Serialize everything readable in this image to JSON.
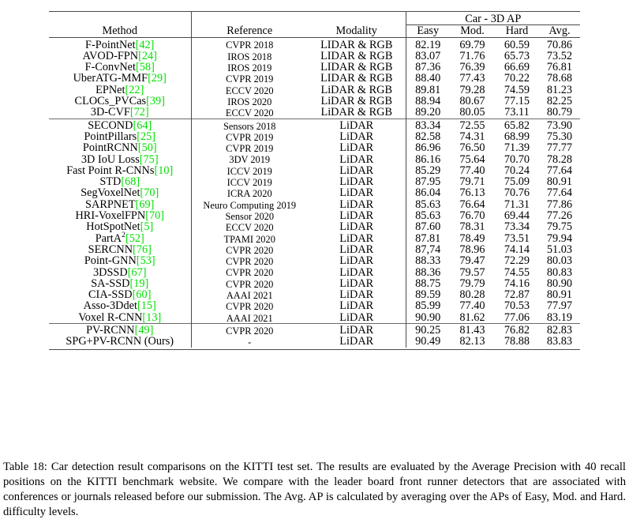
{
  "table": {
    "group_header": "Car - 3D AP",
    "columns": [
      "Method",
      "Reference",
      "Modality",
      "Easy",
      "Mod.",
      "Hard",
      "Avg."
    ],
    "groups": [
      {
        "name": "lidar-rgb-group",
        "rows": [
          {
            "method": "F-PointNet",
            "cite": "42",
            "reference": "CVPR 2018",
            "modality": "LIDAR & RGB",
            "easy": "82.19",
            "mod": "69.79",
            "hard": "60.59",
            "avg": "70.86"
          },
          {
            "method": "AVOD-FPN",
            "cite": "24",
            "reference": "IROS 2018",
            "modality": "LIDAR & RGB",
            "easy": "83.07",
            "mod": "71.76",
            "hard": "65.73",
            "avg": "73.52"
          },
          {
            "method": "F-ConvNet",
            "cite": "58",
            "reference": "IROS 2019",
            "modality": "LIDAR & RGB",
            "easy": "87.36",
            "mod": "76.39",
            "hard": "66.69",
            "avg": "76.81"
          },
          {
            "method": "UberATG-MMF",
            "cite": "29",
            "reference": "CVPR 2019",
            "modality": "LIDAR & RGB",
            "easy": "88.40",
            "mod": "77.43",
            "hard": "70.22",
            "avg": "78.68"
          },
          {
            "method": "EPNet",
            "cite": "22",
            "reference": "ECCV 2020",
            "modality": "LiDAR & RGB",
            "easy": "89.81",
            "mod": "79.28",
            "hard": "74.59",
            "avg": "81.23"
          },
          {
            "method": "CLOCs_PVCas",
            "cite": "39",
            "reference": "IROS 2020",
            "modality": "LiDAR & RGB",
            "easy": "88.94",
            "mod": "80.67",
            "hard": "77.15",
            "avg": "82.25"
          },
          {
            "method": "3D-CVF",
            "cite": "72",
            "reference": "ECCV 2020",
            "modality": "LiDAR & RGB",
            "easy": "89.20",
            "mod": "80.05",
            "hard": "73.11",
            "avg": "80.79"
          }
        ]
      },
      {
        "name": "lidar-group",
        "rows": [
          {
            "method": "SECOND",
            "cite": "64",
            "reference": "Sensors 2018",
            "modality": "LiDAR",
            "easy": "83.34",
            "mod": "72.55",
            "hard": "65.82",
            "avg": "73.90"
          },
          {
            "method": "PointPillars",
            "cite": "25",
            "reference": "CVPR 2019",
            "modality": "LiDAR",
            "easy": "82.58",
            "mod": "74.31",
            "hard": "68.99",
            "avg": "75.30"
          },
          {
            "method": "PointRCNN",
            "cite": "50",
            "reference": "CVPR 2019",
            "modality": "LiDAR",
            "easy": "86.96",
            "mod": "76.50",
            "hard": "71.39",
            "avg": "77.77"
          },
          {
            "method": "3D IoU Loss",
            "cite": "75",
            "reference": "3DV 2019",
            "modality": "LiDAR",
            "easy": "86.16",
            "mod": "75.64",
            "hard": "70.70",
            "avg": "78.28"
          },
          {
            "method": "Fast Point R-CNNs",
            "cite": "10",
            "reference": "ICCV 2019",
            "modality": "LiDAR",
            "easy": "85.29",
            "mod": "77.40",
            "hard": "70.24",
            "avg": "77.64"
          },
          {
            "method": "STD",
            "cite": "68",
            "reference": "ICCV 2019",
            "modality": "LiDAR",
            "easy": "87.95",
            "mod": "79.71",
            "hard": "75.09",
            "avg": "80.91",
            "bold": [
              "mod",
              "hard"
            ]
          },
          {
            "method": "SegVoxelNet",
            "cite": "70",
            "reference": "ICRA 2020",
            "modality": "LiDAR",
            "easy": "86.04",
            "mod": "76.13",
            "hard": "70.76",
            "avg": "77.64"
          },
          {
            "method": "SARPNET",
            "cite": "69",
            "reference": "Neuro Computing 2019",
            "modality": "LiDAR",
            "easy": "85.63",
            "mod": "76.64",
            "hard": "71.31",
            "avg": "77.86"
          },
          {
            "method": "HRI-VoxelFPN",
            "cite": "70",
            "reference": "Sensor 2020",
            "modality": "LiDAR",
            "easy": "85.63",
            "mod": "76.70",
            "hard": "69.44",
            "avg": "77.26"
          },
          {
            "method": "HotSpotNet",
            "cite": "5",
            "reference": "ECCV 2020",
            "modality": "LiDAR",
            "easy": "87.60",
            "mod": "78.31",
            "hard": "73.34",
            "avg": "79.75"
          },
          {
            "method": "PartA",
            "method_sup": "2",
            "cite": "52",
            "reference": "TPAMI 2020",
            "modality": "LiDAR",
            "easy": "87.81",
            "mod": "78.49",
            "hard": "73.51",
            "avg": "79.94"
          },
          {
            "method": "SERCNN",
            "cite": "76",
            "reference": "CVPR 2020",
            "modality": "LiDAR",
            "easy": "87,74",
            "mod": "78.96",
            "hard": "74.14",
            "avg": "51.03"
          },
          {
            "method": "Point-GNN",
            "cite": "53",
            "reference": "CVPR 2020",
            "modality": "LiDAR",
            "easy": "88.33",
            "mod": "79.47",
            "hard": "72.29",
            "avg": "80.03"
          },
          {
            "method": "3DSSD",
            "cite": "67",
            "reference": "CVPR 2020",
            "modality": "LiDAR",
            "easy": "88.36",
            "mod": "79.57",
            "hard": "74.55",
            "avg": "80.83"
          },
          {
            "method": "SA-SSD",
            "cite": "19",
            "reference": "CVPR 2020",
            "modality": "LiDAR",
            "easy": "88.75",
            "mod": "79.79",
            "hard": "74.16",
            "avg": "80.90"
          },
          {
            "method": "CIA-SSD",
            "cite": "60",
            "reference": "AAAI 2021",
            "modality": "LiDAR",
            "easy": "89.59",
            "mod": "80.28",
            "hard": "72.87",
            "avg": "80.91"
          },
          {
            "method": "Asso-3Ddet",
            "cite": "15",
            "reference": "CVPR 2020",
            "modality": "LiDAR",
            "easy": "85.99",
            "mod": "77.40",
            "hard": "70.53",
            "avg": "77.97"
          },
          {
            "method": "Voxel R-CNN",
            "cite": "13",
            "reference": "AAAI 2021",
            "modality": "LiDAR",
            "easy": "90.90",
            "mod": "81.62",
            "hard": "77.06",
            "avg": "83.19",
            "bold": [
              "easy"
            ]
          }
        ]
      },
      {
        "name": "ours-group",
        "rows": [
          {
            "method": "PV-RCNN",
            "cite": "49",
            "reference": "CVPR 2020",
            "modality": "LiDAR",
            "easy": "90.25",
            "mod": "81.43",
            "hard": "76.82",
            "avg": "82.83"
          },
          {
            "method": "SPG+PV-RCNN (Ours)",
            "cite": "",
            "reference": "-",
            "modality": "LiDAR",
            "easy": "90.49",
            "mod": "82.13",
            "hard": "78.88",
            "avg": "83.83",
            "bold": [
              "mod",
              "hard",
              "avg"
            ]
          }
        ]
      }
    ]
  },
  "caption": {
    "text": "Table 18: Car detection result comparisons on the KITTI test set. The results are evaluated by the Average Precision with 40 recall positions on the KITTI benchmark website. We compare with the leader board front runner detectors that are associated with conferences or journals released before our submission. The Avg. AP is calculated by averaging over the APs of Easy, Mod. and Hard. difficulty levels."
  },
  "colors": {
    "citation_green": "#00e000",
    "rule_gray": "#4a4a4a",
    "text": "#000000"
  }
}
